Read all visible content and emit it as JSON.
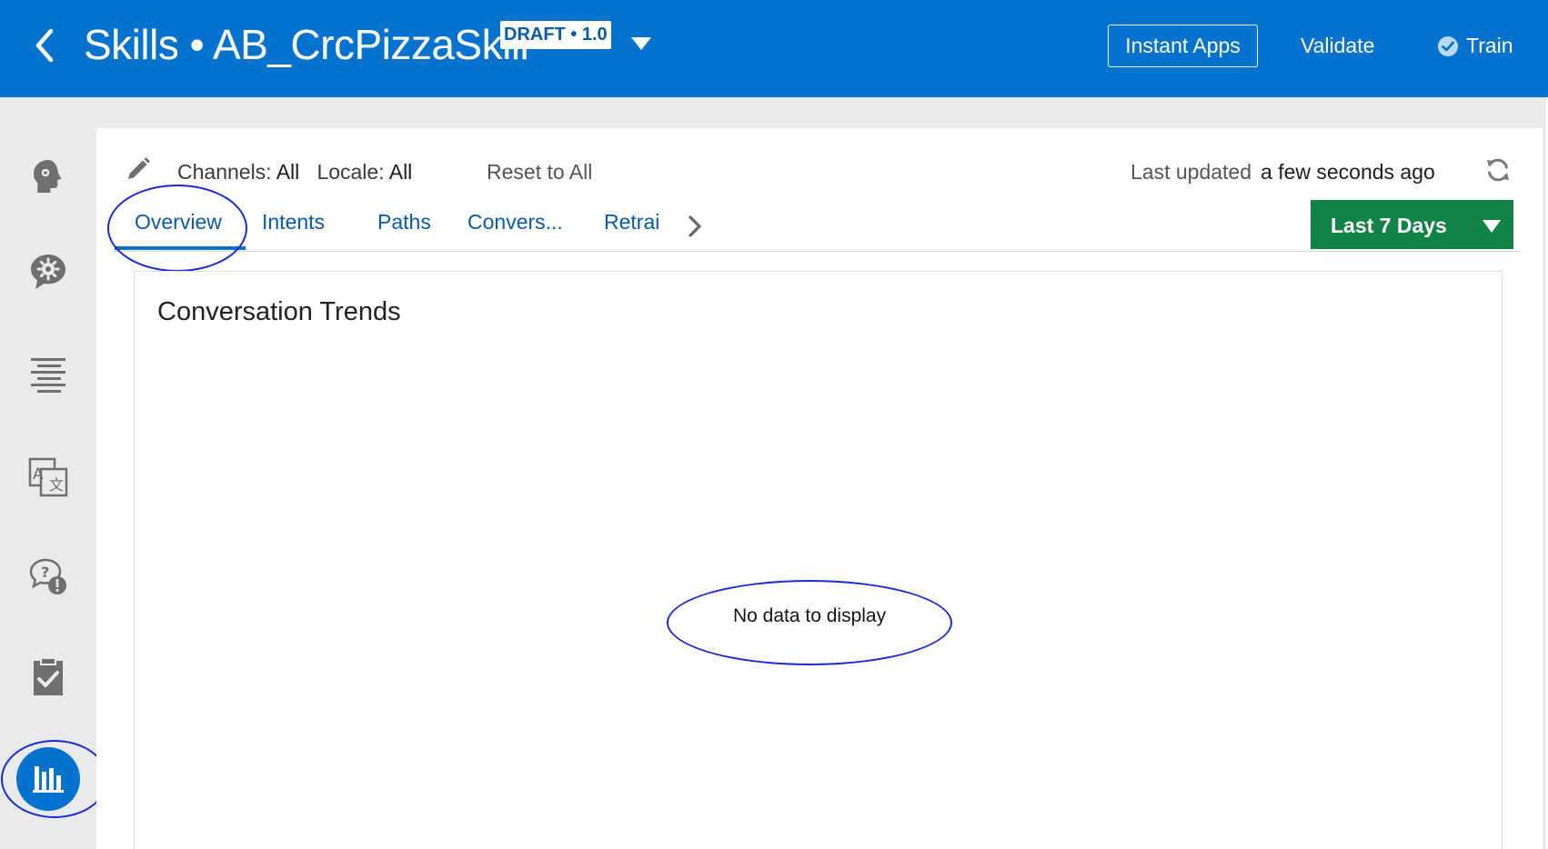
{
  "header": {
    "title": "Skills • AB_CrcPizzaSkill",
    "version_badge": "DRAFT • 1.0",
    "instant_apps_label": "Instant Apps",
    "validate_label": "Validate",
    "train_label": "Train",
    "background_color": "#0572ce"
  },
  "left_rail": {
    "icons": [
      "intents-icon",
      "entities-icon",
      "flows-icon",
      "resource-bundles-icon",
      "qna-icon",
      "quality-icon",
      "insights-icon"
    ],
    "active": "insights-icon"
  },
  "filters": {
    "channels_label": "Channels:",
    "channels_value": "All",
    "locale_label": "Locale:",
    "locale_value": "All",
    "reset_label": "Reset to All",
    "last_updated_label": "Last updated",
    "last_updated_value": "a few seconds ago"
  },
  "tabs": [
    {
      "label": "Overview",
      "active": true
    },
    {
      "label": "Intents",
      "active": false
    },
    {
      "label": "Paths",
      "active": false
    },
    {
      "label": "Convers...",
      "active": false
    },
    {
      "label": "Retrai",
      "active": false
    }
  ],
  "date_range": {
    "selected": "Last 7 Days",
    "color": "#138247"
  },
  "card": {
    "title": "Conversation Trends",
    "empty_message": "No data to display"
  }
}
